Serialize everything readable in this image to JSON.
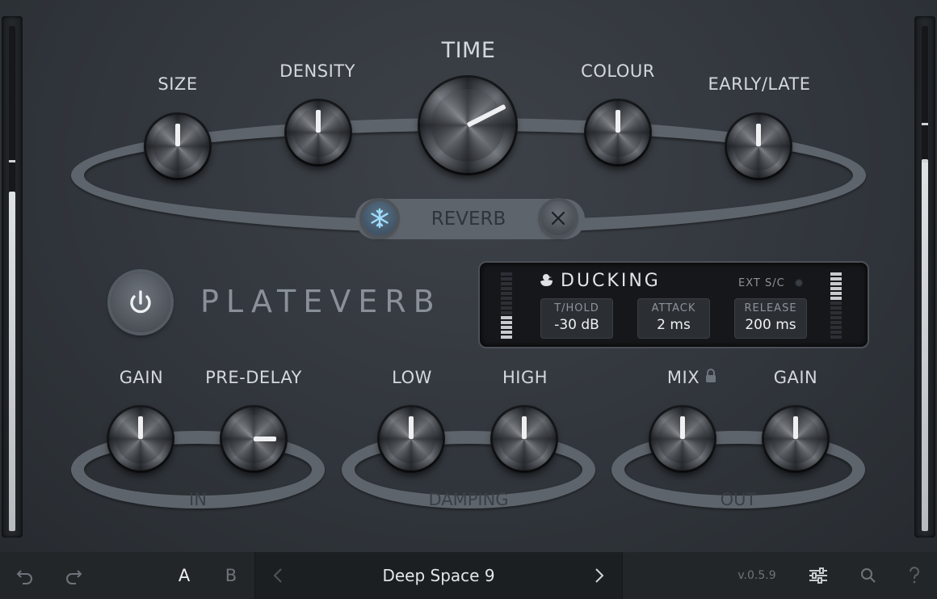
{
  "reverb": {
    "size_label": "SIZE",
    "density_label": "DENSITY",
    "time_label": "TIME",
    "colour_label": "COLOUR",
    "early_late_label": "EARLY/LATE",
    "section_label": "REVERB"
  },
  "brand": {
    "name": "PLATEVERB"
  },
  "ducking": {
    "title": "DUCKING",
    "ext_sc_label": "EXT S/C",
    "fields": [
      {
        "label": "T/HOLD",
        "value": "-30 dB"
      },
      {
        "label": "ATTACK",
        "value": "2 ms"
      },
      {
        "label": "RELEASE",
        "value": "200 ms"
      }
    ]
  },
  "input": {
    "gain_label": "GAIN",
    "predelay_label": "PRE-DELAY",
    "section_label": "IN"
  },
  "damping": {
    "low_label": "LOW",
    "high_label": "HIGH",
    "section_label": "DAMPING"
  },
  "output": {
    "mix_label": "MIX",
    "gain_label": "GAIN",
    "section_label": "OUT"
  },
  "bottom_bar": {
    "ab_a": "A",
    "ab_b": "B",
    "preset_name": "Deep Space 9",
    "version": "v.0.5.9"
  },
  "colors": {
    "accent_freeze": "#8fd3ff",
    "panel": "#31363c",
    "indicator": "#eef0f2"
  },
  "icons": [
    "undo-icon",
    "redo-icon",
    "chevron-left-icon",
    "chevron-right-icon",
    "sliders-icon",
    "search-icon",
    "help-icon",
    "snowflake-icon",
    "close-icon",
    "power-icon",
    "duck-icon",
    "lock-icon"
  ]
}
